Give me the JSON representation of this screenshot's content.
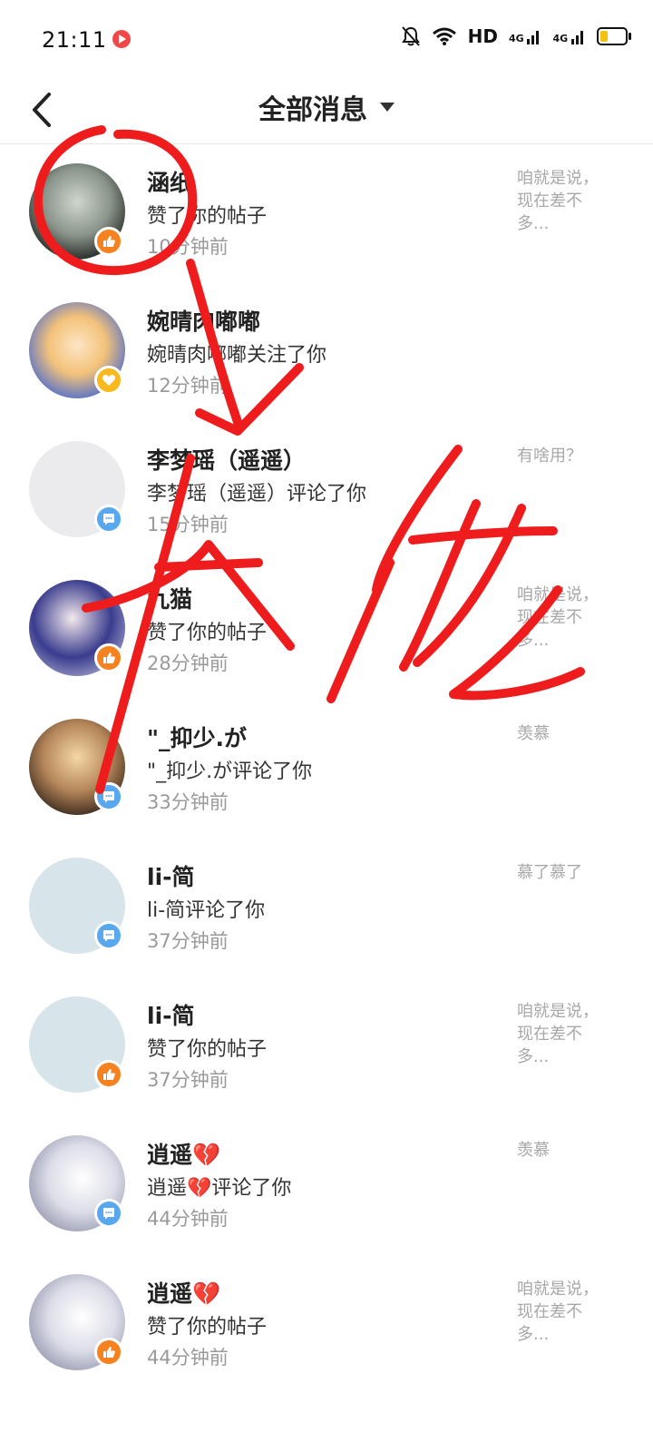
{
  "status_bar": {
    "time": "21:11",
    "hd_label": "HD",
    "net1": "4G",
    "net2": "4G",
    "battery_level_percent": 30,
    "battery_color": "#f4c20d"
  },
  "header": {
    "title": "全部消息"
  },
  "messages": [
    {
      "name": "涵纸",
      "action": "赞了你的帖子",
      "time": "10分钟前",
      "preview": "咱就是说，现在差不多...",
      "badge": "like"
    },
    {
      "name": "婉晴肉嘟嘟",
      "action": "婉晴肉嘟嘟关注了你",
      "time": "12分钟前",
      "preview": "",
      "badge": "follow"
    },
    {
      "name": "李梦瑶（遥遥）",
      "action": "李梦瑶（遥遥）评论了你",
      "time": "15分钟前",
      "preview": "有啥用？",
      "badge": "comment"
    },
    {
      "name": "九猫",
      "action": "赞了你的帖子",
      "time": "28分钟前",
      "preview": "咱就是说，现在差不多...",
      "badge": "like"
    },
    {
      "name": "\"_抑少.が",
      "action": "\"_抑少.が评论了你",
      "time": "33分钟前",
      "preview": "羡慕",
      "badge": "comment"
    },
    {
      "name": "li-简",
      "action": "li-简评论了你",
      "time": "37分钟前",
      "preview": "慕了慕了",
      "badge": "comment"
    },
    {
      "name": "li-简",
      "action": "赞了你的帖子",
      "time": "37分钟前",
      "preview": "咱就是说，现在差不多...",
      "badge": "like"
    },
    {
      "name": "逍遥💔",
      "action": "逍遥💔评论了你",
      "time": "44分钟前",
      "preview": "羡慕",
      "badge": "comment"
    },
    {
      "name": "逍遥💔",
      "action": "赞了你的帖子",
      "time": "44分钟前",
      "preview": "咱就是说，现在差不多...",
      "badge": "like"
    }
  ],
  "colors": {
    "like_badge": "#f5821f",
    "comment_badge": "#58a8ef",
    "follow_badge": "#f7b91e",
    "scribble": "#ee1c1c"
  }
}
